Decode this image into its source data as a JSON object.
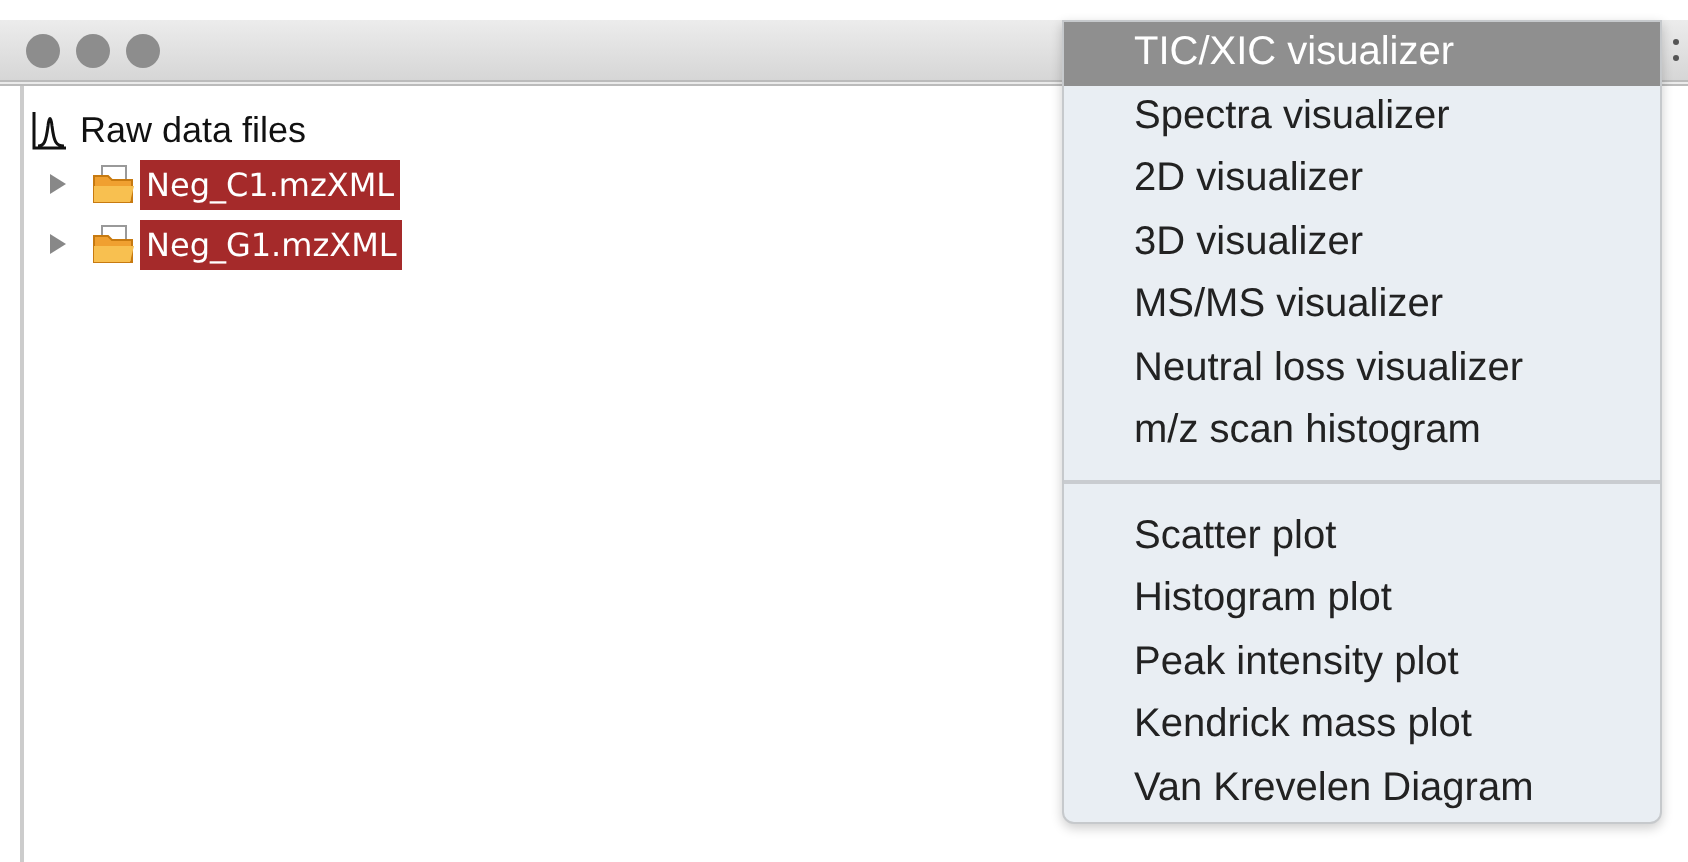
{
  "tree": {
    "label": "Raw data files",
    "children": [
      {
        "label": "Neg_C1.mzXML",
        "selected": true,
        "expanded": false
      },
      {
        "label": "Neg_G1.mzXML",
        "selected": true,
        "expanded": false
      }
    ]
  },
  "menu": {
    "sections": [
      [
        {
          "label": "TIC/XIC visualizer",
          "selected": true
        },
        {
          "label": "Spectra visualizer",
          "selected": false
        },
        {
          "label": "2D visualizer",
          "selected": false
        },
        {
          "label": "3D visualizer",
          "selected": false
        },
        {
          "label": "MS/MS visualizer",
          "selected": false
        },
        {
          "label": "Neutral loss visualizer",
          "selected": false
        },
        {
          "label": "m/z scan histogram",
          "selected": false
        }
      ],
      [
        {
          "label": "Scatter plot",
          "selected": false
        },
        {
          "label": "Histogram plot",
          "selected": false
        },
        {
          "label": "Peak intensity plot",
          "selected": false
        },
        {
          "label": "Kendrick mass plot",
          "selected": false
        },
        {
          "label": "Van Krevelen Diagram",
          "selected": false
        }
      ]
    ]
  }
}
